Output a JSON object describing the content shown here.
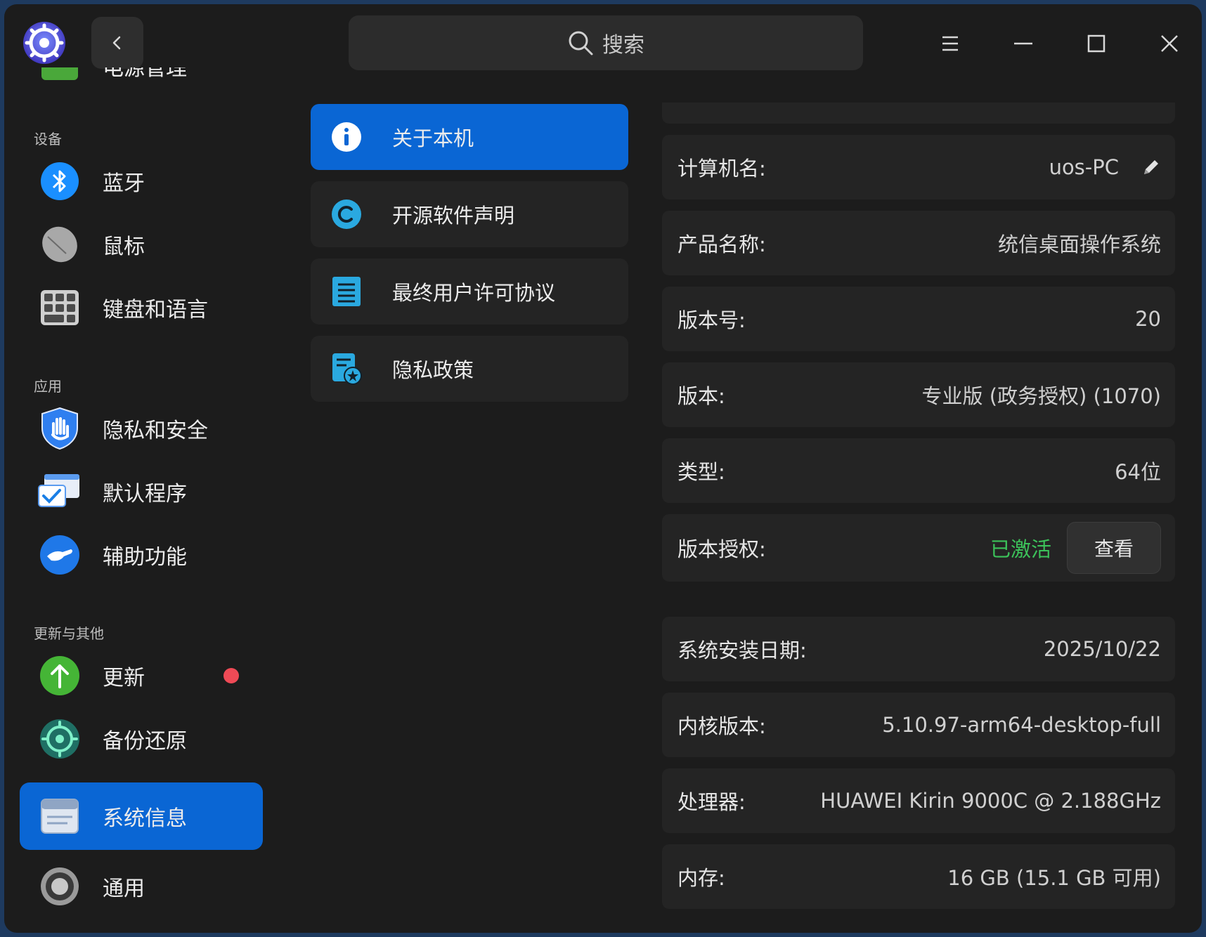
{
  "titlebar": {
    "search_placeholder": "搜索"
  },
  "sidebar": {
    "partial_item": "电源管理",
    "sections": {
      "devices": "设备",
      "apps": "应用",
      "updates": "更新与其他"
    },
    "items": [
      {
        "label": "蓝牙",
        "icon": "bluetooth-icon"
      },
      {
        "label": "鼠标",
        "icon": "mouse-icon"
      },
      {
        "label": "键盘和语言",
        "icon": "keyboard-icon"
      },
      {
        "label": "隐私和安全",
        "icon": "privacy-shield-icon"
      },
      {
        "label": "默认程序",
        "icon": "default-apps-icon"
      },
      {
        "label": "辅助功能",
        "icon": "accessibility-icon"
      },
      {
        "label": "更新",
        "icon": "update-icon",
        "has_badge": true
      },
      {
        "label": "备份还原",
        "icon": "backup-icon"
      },
      {
        "label": "系统信息",
        "icon": "system-info-icon",
        "active": true
      },
      {
        "label": "通用",
        "icon": "general-gear-icon"
      }
    ]
  },
  "submenu": {
    "items": [
      {
        "label": "关于本机",
        "icon": "info-icon",
        "active": true
      },
      {
        "label": "开源软件声明",
        "icon": "copyright-icon"
      },
      {
        "label": "最终用户许可协议",
        "icon": "license-doc-icon"
      },
      {
        "label": "隐私政策",
        "icon": "privacy-doc-icon"
      }
    ]
  },
  "about": {
    "computer_name": {
      "key": "计算机名:",
      "value": "uos-PC"
    },
    "product_name": {
      "key": "产品名称:",
      "value": "统信桌面操作系统"
    },
    "version_number": {
      "key": "版本号:",
      "value": "20"
    },
    "edition": {
      "key": "版本:",
      "value": "专业版 (政务授权) (1070)"
    },
    "type": {
      "key": "类型:",
      "value": "64位"
    },
    "license": {
      "key": "版本授权:",
      "status": "已激活",
      "button": "查看"
    },
    "install_date": {
      "key": "系统安装日期:",
      "value": "2025/10/22"
    },
    "kernel": {
      "key": "内核版本:",
      "value": "5.10.97-arm64-desktop-full"
    },
    "processor": {
      "key": "处理器:",
      "value": "HUAWEI Kirin 9000C @ 2.188GHz"
    },
    "memory": {
      "key": "内存:",
      "value": "16 GB (15.1 GB 可用)"
    }
  },
  "colors": {
    "accent": "#0a66d4",
    "activated": "#3cc25a",
    "badge": "#ef4a56"
  }
}
